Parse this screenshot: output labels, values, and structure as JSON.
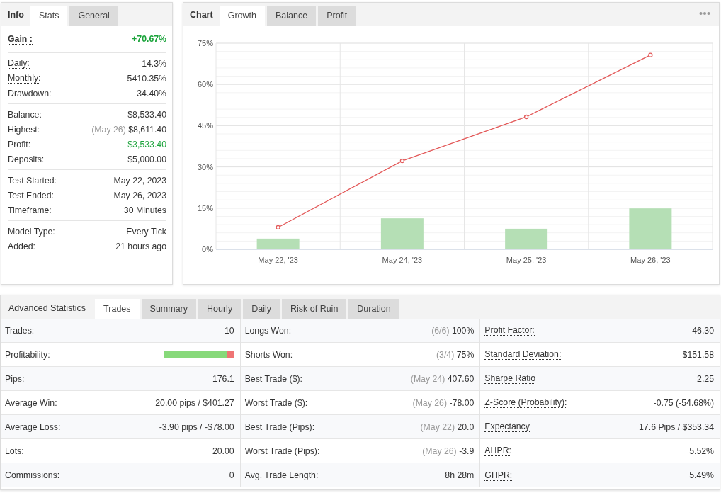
{
  "info_panel": {
    "title": "Info",
    "tabs": [
      {
        "label": "Stats",
        "selected": true
      },
      {
        "label": "General",
        "selected": false
      }
    ],
    "groups": [
      [
        {
          "label": "Gain :",
          "value": "+70.67%",
          "dotted": true,
          "positive": true,
          "kind": "headline"
        }
      ],
      [
        {
          "label": "Daily:",
          "value": "14.3%",
          "dotted": true,
          "positive": false,
          "kind": "plain"
        },
        {
          "label": "Monthly:",
          "value": "5410.35%",
          "dotted": true,
          "positive": false,
          "kind": "plain"
        },
        {
          "label": "Drawdown:",
          "value": "34.40%",
          "dotted": false,
          "positive": false,
          "kind": "plain"
        }
      ],
      [
        {
          "label": "Balance:",
          "value": "$8,533.40",
          "dotted": false,
          "positive": false,
          "kind": "plain"
        },
        {
          "label": "Highest:",
          "note": "(May 26)",
          "value": "$8,611.40",
          "dotted": false,
          "positive": false,
          "kind": "plain"
        },
        {
          "label": "Profit:",
          "value": "$3,533.40",
          "dotted": false,
          "positive": true,
          "kind": "plain"
        },
        {
          "label": "Deposits:",
          "value": "$5,000.00",
          "dotted": false,
          "positive": false,
          "kind": "plain"
        }
      ],
      [
        {
          "label": "Test Started:",
          "value": "May 22, 2023",
          "dotted": false,
          "positive": false,
          "kind": "plain"
        },
        {
          "label": "Test Ended:",
          "value": "May 26, 2023",
          "dotted": false,
          "positive": false,
          "kind": "plain"
        },
        {
          "label": "Timeframe:",
          "value": "30 Minutes",
          "dotted": false,
          "positive": false,
          "kind": "plain"
        }
      ],
      [
        {
          "label": "Model Type:",
          "value": "Every Tick",
          "dotted": false,
          "positive": false,
          "kind": "plain"
        },
        {
          "label": "Added:",
          "value": "21 hours ago",
          "dotted": false,
          "positive": false,
          "kind": "plain"
        }
      ]
    ]
  },
  "chart_panel": {
    "title": "Chart",
    "tabs": [
      {
        "label": "Growth",
        "selected": true
      },
      {
        "label": "Balance",
        "selected": false
      },
      {
        "label": "Profit",
        "selected": false
      }
    ],
    "chart_data": {
      "type": "bar",
      "grid": true,
      "categories": [
        "May 22, '23",
        "May 24, '23",
        "May 25, '23",
        "May 26, '23"
      ],
      "ylim": [
        0,
        75
      ],
      "yticks": [
        {
          "value": 0,
          "label": "0%"
        },
        {
          "value": 15,
          "label": "15%"
        },
        {
          "value": 30,
          "label": "30%"
        },
        {
          "value": 45,
          "label": "45%"
        },
        {
          "value": 60,
          "label": "60%"
        },
        {
          "value": 75,
          "label": "75%"
        }
      ],
      "series": [
        {
          "color": "#b5dfb5",
          "values": [
            3.9,
            11.3,
            7.5,
            14.9
          ]
        },
        {
          "type": "line",
          "marker": "circle",
          "color": "#e35858",
          "values": [
            8.0,
            32.2,
            48.2,
            70.7
          ]
        }
      ]
    }
  },
  "stats_panel": {
    "title": "Advanced Statistics",
    "tabs": [
      {
        "label": "Trades",
        "selected": true
      },
      {
        "label": "Summary",
        "selected": false
      },
      {
        "label": "Hourly",
        "selected": false
      },
      {
        "label": "Daily",
        "selected": false
      },
      {
        "label": "Risk of Ruin",
        "selected": false
      },
      {
        "label": "Duration",
        "selected": false
      }
    ],
    "columns": [
      [
        {
          "kind": "text",
          "label": "Trades:",
          "value": "10",
          "dotted": false
        },
        {
          "kind": "bar",
          "label": "Profitability:",
          "level": 0.9,
          "dotted": false
        },
        {
          "kind": "text",
          "label": "Pips:",
          "value": "176.1",
          "dotted": false
        },
        {
          "kind": "text",
          "label": "Average Win:",
          "value": "20.00 pips / $401.27",
          "dotted": false
        },
        {
          "kind": "text",
          "label": "Average Loss:",
          "value": "-3.90 pips / -$78.00",
          "dotted": false
        },
        {
          "kind": "text",
          "label": "Lots:",
          "value": "20.00",
          "dotted": false
        },
        {
          "kind": "text",
          "label": "Commissions:",
          "value": "0",
          "dotted": false
        }
      ],
      [
        {
          "kind": "text",
          "label": "Longs Won:",
          "note": "(6/6)",
          "value": "100%",
          "dotted": false
        },
        {
          "kind": "text",
          "label": "Shorts Won:",
          "note": "(3/4)",
          "value": "75%",
          "dotted": false
        },
        {
          "kind": "text",
          "label": "Best Trade ($):",
          "note": "(May 24)",
          "value": "407.60",
          "dotted": false
        },
        {
          "kind": "text",
          "label": "Worst Trade ($):",
          "note": "(May 26)",
          "value": "-78.00",
          "dotted": false
        },
        {
          "kind": "text",
          "label": "Best Trade (Pips):",
          "note": "(May 22)",
          "value": "20.0",
          "dotted": false
        },
        {
          "kind": "text",
          "label": "Worst Trade (Pips):",
          "note": "(May 26)",
          "value": "-3.9",
          "dotted": false
        },
        {
          "kind": "text",
          "label": "Avg. Trade Length:",
          "value": "8h 28m",
          "dotted": false
        }
      ],
      [
        {
          "kind": "text",
          "label": "Profit Factor:",
          "value": "46.30",
          "dotted": true
        },
        {
          "kind": "text",
          "label": "Standard Deviation:",
          "value": "$151.58",
          "dotted": true
        },
        {
          "kind": "text",
          "label": "Sharpe Ratio",
          "value": "2.25",
          "dotted": true
        },
        {
          "kind": "text",
          "label": "Z-Score (Probability):",
          "value": "-0.75 (-54.68%)",
          "dotted": true
        },
        {
          "kind": "text",
          "label": "Expectancy",
          "value": "17.6 Pips / $353.34",
          "dotted": true
        },
        {
          "kind": "text",
          "label": "AHPR:",
          "value": "5.52%",
          "dotted": true
        },
        {
          "kind": "text",
          "label": "GHPR:",
          "value": "5.49%",
          "dotted": true
        }
      ]
    ]
  }
}
